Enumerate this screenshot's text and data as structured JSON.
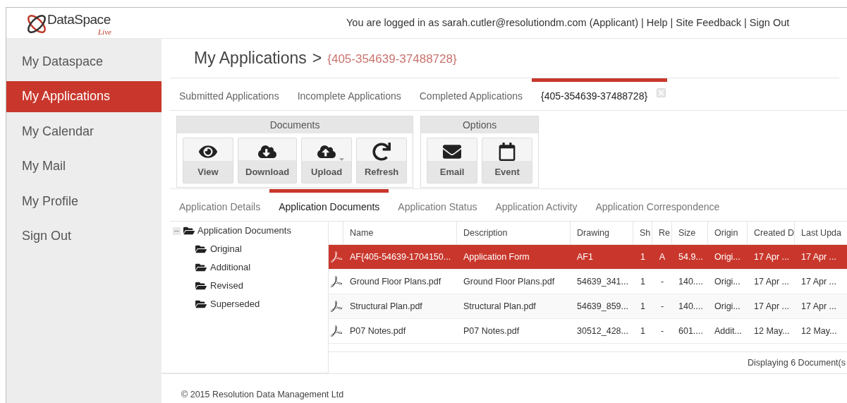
{
  "header": {
    "logo": {
      "name": "DataSpace",
      "tagline": "Live"
    },
    "login_text": "You are logged in as sarah.cutler@resolutiondm.com (Applicant)",
    "separator": "|",
    "links": [
      "Help",
      "Site Feedback",
      "Sign Out"
    ]
  },
  "sidebar": {
    "items": [
      {
        "label": "My Dataspace",
        "selected": false
      },
      {
        "label": "My Applications",
        "selected": true
      },
      {
        "label": "My Calendar",
        "selected": false
      },
      {
        "label": "My Mail",
        "selected": false
      },
      {
        "label": "My Profile",
        "selected": false
      },
      {
        "label": "Sign Out",
        "selected": false
      }
    ]
  },
  "breadcrumb": {
    "title": "My Applications",
    "separator": ">",
    "current": "{405-354639-37488728}"
  },
  "tabs": [
    {
      "label": "Submitted Applications",
      "selected": false,
      "closable": false
    },
    {
      "label": "Incomplete Applications",
      "selected": false,
      "closable": false
    },
    {
      "label": "Completed Applications",
      "selected": false,
      "closable": false
    },
    {
      "label": "{405-354639-37488728}",
      "selected": true,
      "closable": true
    }
  ],
  "toolbar": {
    "groups": [
      {
        "title": "Documents",
        "buttons": [
          {
            "label": "View",
            "dropdown": false
          },
          {
            "label": "Download",
            "dropdown": false
          },
          {
            "label": "Upload",
            "dropdown": true
          },
          {
            "label": "Refresh",
            "dropdown": false
          }
        ]
      },
      {
        "title": "Options",
        "buttons": [
          {
            "label": "Email",
            "dropdown": false
          },
          {
            "label": "Event",
            "dropdown": false
          }
        ]
      }
    ]
  },
  "subtabs": [
    {
      "label": "Application Details",
      "selected": false
    },
    {
      "label": "Application Documents",
      "selected": true
    },
    {
      "label": "Application Status",
      "selected": false
    },
    {
      "label": "Application Activity",
      "selected": false
    },
    {
      "label": "Application Correspondence",
      "selected": false
    }
  ],
  "tree": {
    "label": "Application Documents",
    "expanded": true,
    "children": [
      {
        "label": "Original"
      },
      {
        "label": "Additional"
      },
      {
        "label": "Revised"
      },
      {
        "label": "Superseded"
      }
    ]
  },
  "table": {
    "columns": [
      "Name",
      "Description",
      "Drawing",
      "Sh",
      "Re",
      "Size",
      "Origin",
      "Created D",
      "Last Upda"
    ],
    "rows": [
      {
        "selected": true,
        "cells": [
          "AF{405-54639-1704150...",
          "Application Form",
          "AF1",
          "1",
          "A",
          "54.9...",
          "Origi...",
          "17 Apr ...",
          "17 Apr ..."
        ]
      },
      {
        "selected": false,
        "cells": [
          "Ground Floor Plans.pdf",
          "Ground Floor Plans.pdf",
          "54639_341...",
          "1",
          "-",
          "140....",
          "Origi...",
          "17 Apr ...",
          "17 Apr ..."
        ]
      },
      {
        "selected": false,
        "cells": [
          "Structural Plan.pdf",
          "Structural Plan.pdf",
          "54639_859...",
          "1",
          "-",
          "140....",
          "Origi...",
          "17 Apr ...",
          "17 Apr ..."
        ]
      },
      {
        "selected": false,
        "cells": [
          "P07 Notes.pdf",
          "P07 Notes.pdf",
          "30512_428...",
          "1",
          "-",
          "601....",
          "Addit...",
          "12 May...",
          "12 May..."
        ]
      }
    ],
    "footer": "Displaying 6 Document(s"
  },
  "copyright": "© 2015 Resolution Data Management Ltd"
}
